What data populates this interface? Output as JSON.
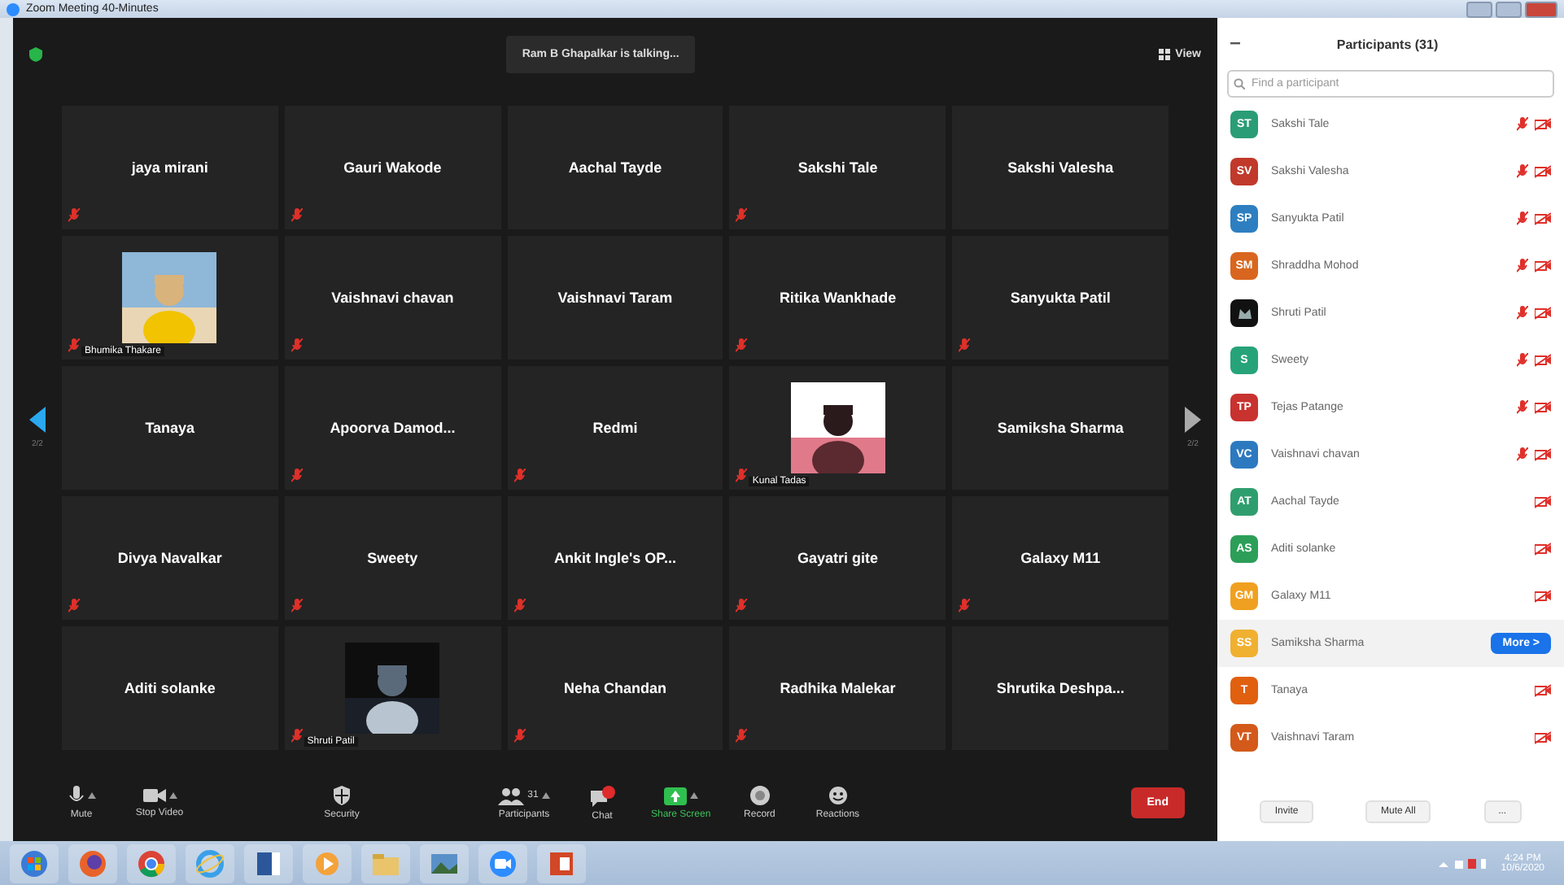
{
  "window": {
    "title": "Zoom Meeting 40-Minutes"
  },
  "meeting": {
    "talking": "Ram B Ghapalkar is talking...",
    "view": "View",
    "page_left": "2/2",
    "page_right": "2/2",
    "tiles": [
      {
        "name": "jaya mirani",
        "muted": true,
        "kind": "name"
      },
      {
        "name": "Gauri Wakode",
        "muted": true,
        "kind": "name"
      },
      {
        "name": "Aachal Tayde",
        "muted": false,
        "kind": "name"
      },
      {
        "name": "Sakshi Tale",
        "muted": true,
        "kind": "name"
      },
      {
        "name": "Sakshi Valesha",
        "muted": false,
        "kind": "name"
      },
      {
        "name": "Bhumika Thakare",
        "muted": true,
        "kind": "picture"
      },
      {
        "name": "Vaishnavi chavan",
        "muted": true,
        "kind": "name"
      },
      {
        "name": "Vaishnavi Taram",
        "muted": false,
        "kind": "name"
      },
      {
        "name": "Ritika Wankhade",
        "muted": true,
        "kind": "name"
      },
      {
        "name": "Sanyukta Patil",
        "muted": true,
        "kind": "name"
      },
      {
        "name": "Tanaya",
        "muted": false,
        "kind": "name"
      },
      {
        "name": "Apoorva  Damod...",
        "muted": true,
        "kind": "name"
      },
      {
        "name": "Redmi",
        "muted": true,
        "kind": "name"
      },
      {
        "name": "Kunal Tadas",
        "muted": true,
        "kind": "picture"
      },
      {
        "name": "Samiksha Sharma",
        "muted": false,
        "kind": "name"
      },
      {
        "name": "Divya Navalkar",
        "muted": true,
        "kind": "name"
      },
      {
        "name": "Sweety",
        "muted": true,
        "kind": "name"
      },
      {
        "name": "Ankit Ingle's OP...",
        "muted": true,
        "kind": "name"
      },
      {
        "name": "Gayatri gite",
        "muted": true,
        "kind": "name"
      },
      {
        "name": "Galaxy M11",
        "muted": true,
        "kind": "name"
      },
      {
        "name": "Aditi solanke",
        "muted": false,
        "kind": "name"
      },
      {
        "name": "Shruti Patil",
        "muted": true,
        "kind": "picture"
      },
      {
        "name": "Neha Chandan",
        "muted": true,
        "kind": "name"
      },
      {
        "name": "Radhika Malekar",
        "muted": true,
        "kind": "name"
      },
      {
        "name": "Shrutika  Deshpa...",
        "muted": false,
        "kind": "name"
      }
    ],
    "toolbar": [
      {
        "label": "Mute",
        "kind": "mic",
        "menu": true
      },
      {
        "label": "Stop Video",
        "kind": "camera",
        "menu": true
      },
      {
        "label": "Security",
        "kind": "shield",
        "menu": false
      },
      {
        "label": "Participants",
        "kind": "people",
        "count": "31",
        "menu": true
      },
      {
        "label": "Chat",
        "kind": "chat",
        "menu": false
      },
      {
        "label": "Share Screen",
        "kind": "share",
        "menu": true
      },
      {
        "label": "Record",
        "kind": "record",
        "menu": false
      },
      {
        "label": "Reactions",
        "kind": "smile",
        "menu": false
      }
    ],
    "end": "End"
  },
  "participants": {
    "title": "Participants (31)",
    "search": {
      "placeholder": "Find a participant"
    },
    "items": [
      {
        "initials": "ST",
        "name": "Sakshi Tale",
        "color": "#2a9d76",
        "muted": true,
        "video_off": true,
        "hovered": false
      },
      {
        "initials": "SV",
        "name": "Sakshi Valesha",
        "color": "#c0392b",
        "muted": true,
        "video_off": true,
        "hovered": false
      },
      {
        "initials": "SP",
        "name": "Sanyukta Patil",
        "color": "#2d7fc1",
        "muted": true,
        "video_off": true,
        "hovered": false
      },
      {
        "initials": "SM",
        "name": "Shraddha Mohod",
        "color": "#d9661f",
        "muted": true,
        "video_off": true,
        "hovered": false
      },
      {
        "name": "Shruti Patil",
        "color": "#111111",
        "muted": true,
        "video_off": true,
        "hovered": false
      },
      {
        "initials": "S",
        "name": "Sweety",
        "color": "#27a37a",
        "muted": true,
        "video_off": true,
        "hovered": false
      },
      {
        "initials": "TP",
        "name": "Tejas Patange",
        "color": "#c8322f",
        "muted": true,
        "video_off": true,
        "hovered": false
      },
      {
        "initials": "VC",
        "name": "Vaishnavi chavan",
        "color": "#2d79c0",
        "muted": true,
        "video_off": true,
        "hovered": false
      },
      {
        "initials": "AT",
        "name": "Aachal Tayde",
        "color": "#2f9e6e",
        "muted": false,
        "video_off": true,
        "hovered": false
      },
      {
        "initials": "AS",
        "name": "Aditi solanke",
        "color": "#2c9e58",
        "muted": false,
        "video_off": true,
        "hovered": false
      },
      {
        "initials": "GM",
        "name": "Galaxy M11",
        "color": "#f0a020",
        "muted": false,
        "video_off": true,
        "hovered": false
      },
      {
        "initials": "SS",
        "name": "Samiksha Sharma",
        "color": "#f0b030",
        "muted": false,
        "video_off": false,
        "hovered": true,
        "action": "More >"
      },
      {
        "initials": "T",
        "name": "Tanaya",
        "color": "#e06010",
        "muted": false,
        "video_off": true,
        "hovered": false
      },
      {
        "initials": "VT",
        "name": "Vaishnavi Taram",
        "color": "#d35a1a",
        "muted": false,
        "video_off": true,
        "hovered": false
      }
    ],
    "buttons": [
      "Invite",
      "Mute All",
      "..."
    ]
  },
  "taskbar": {
    "apps": [
      {
        "kind": "start"
      },
      {
        "kind": "firefox"
      },
      {
        "kind": "chrome"
      },
      {
        "kind": "ie"
      },
      {
        "kind": "word"
      },
      {
        "kind": "media"
      },
      {
        "kind": "folder"
      },
      {
        "kind": "photos"
      },
      {
        "kind": "zoom"
      },
      {
        "kind": "powerpoint"
      }
    ],
    "time": "4:24 PM",
    "date": "10/6/2020"
  }
}
